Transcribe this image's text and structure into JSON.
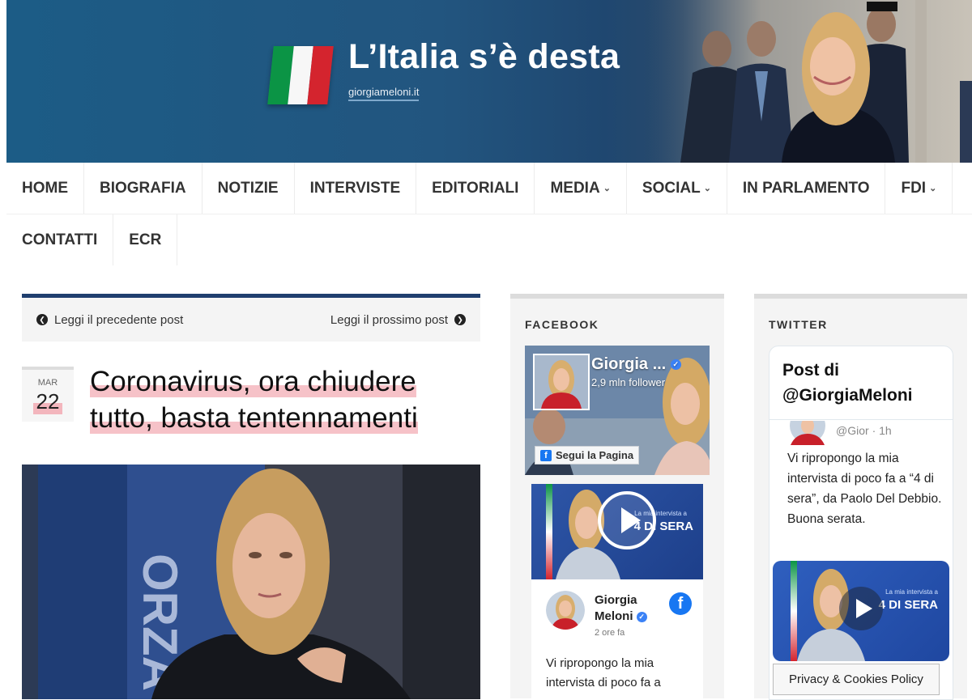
{
  "header": {
    "site_title": "L’Italia s’è desta",
    "site_url": "giorgiameloni.it",
    "flag_colors": [
      "#0b9445",
      "#ffffff",
      "#d4242e"
    ]
  },
  "nav": {
    "row1": [
      {
        "label": "HOME",
        "dropdown": false
      },
      {
        "label": "BIOGRAFIA",
        "dropdown": false
      },
      {
        "label": "NOTIZIE",
        "dropdown": false
      },
      {
        "label": "INTERVISTE",
        "dropdown": false
      },
      {
        "label": "EDITORIALI",
        "dropdown": false
      },
      {
        "label": "MEDIA",
        "dropdown": true
      },
      {
        "label": "SOCIAL",
        "dropdown": true
      },
      {
        "label": "IN PARLAMENTO",
        "dropdown": false
      },
      {
        "label": "FDI",
        "dropdown": true
      }
    ],
    "row2": [
      {
        "label": "CONTATTI",
        "dropdown": false
      },
      {
        "label": "ECR",
        "dropdown": false
      }
    ]
  },
  "post": {
    "prev_label": "Leggi il precedente post",
    "next_label": "Leggi il prossimo post",
    "date_month": "MAR",
    "date_day": "22",
    "title": "Coronavirus, ora chiudere tutto, basta tentennamenti",
    "accent_color": "#1f3e6e"
  },
  "facebook": {
    "widget_title": "FACEBOOK",
    "page_name": "Giorgia ...",
    "followers": "2,9 mln follower",
    "follow_button": "Segui la Pagina",
    "video_caption": "4 DI SERA",
    "video_subcaption": "La mia intervista a",
    "author_line1": "Giorgia",
    "author_line2": "Meloni",
    "time": "2 ore fa",
    "text": "Vi ripropongo la mia intervista di poco fa a"
  },
  "twitter": {
    "widget_title": "TWITTER",
    "heading_line1": "Post di",
    "heading_line2": "@GiorgiaMeloni",
    "handle": "@Gior",
    "handle_time": "· 1h",
    "text": "Vi ripropongo la mia intervista di poco fa a “4 di sera”, da Paolo Del Debbio. Buona serata.",
    "media_caption": "4 DI SERA",
    "media_subcaption": "La mia intervista a"
  },
  "privacy_button": "Privacy & Cookies Policy"
}
